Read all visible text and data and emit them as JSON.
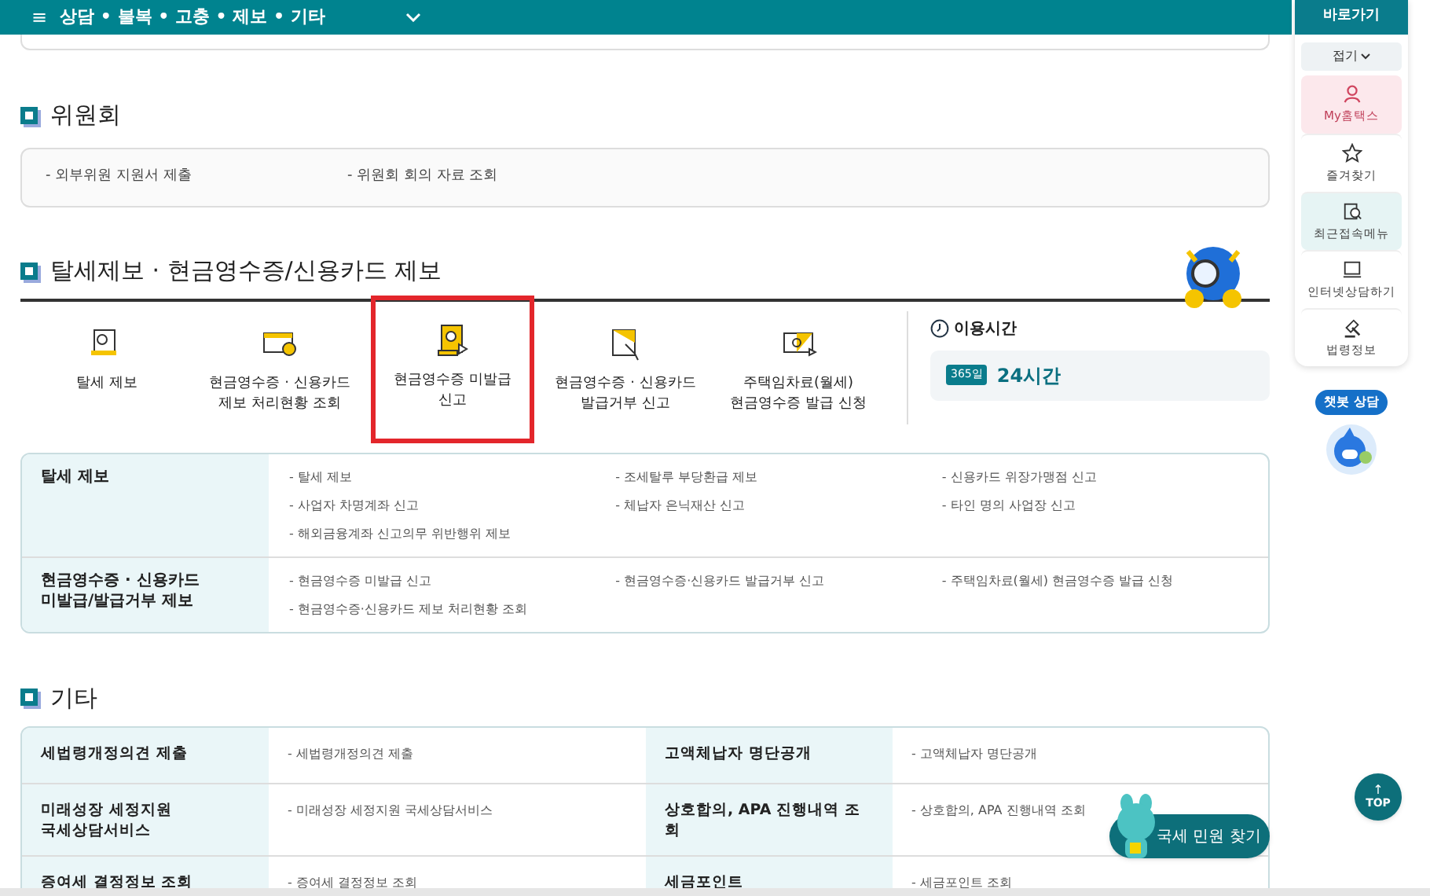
{
  "top_bar": {
    "menu_icon": "≡",
    "title": "상담 • 불복 • 고충 • 제보 • 기타"
  },
  "sections": [
    {
      "kind": "list",
      "title": "위원회",
      "items": [
        "- 외부위원 지원서 제출",
        "- 위원회 회의 자료 조회"
      ]
    },
    {
      "kind": "icons",
      "title": "탈세제보 · 현금영수증/신용카드 제보",
      "icon_items": [
        {
          "label": "탈세 제보",
          "selected": false
        },
        {
          "label": "현금영수증 · 신용카드\n제보 처리현황 조회",
          "selected": false
        },
        {
          "label": "현금영수증 미발급\n신고",
          "selected": true
        },
        {
          "label": "현금영수증 · 신용카드\n발급거부 신고",
          "selected": false
        },
        {
          "label": "주택임차료(월세)\n현금영수증 발급 신청",
          "selected": false
        }
      ],
      "hours": {
        "title": "이용시간",
        "badge": "365일",
        "value": "24시간"
      },
      "rows": [
        {
          "header": "탈세 제보",
          "items": [
            "- 탈세 제보",
            "- 조세탈루 부당환급 제보",
            "- 신용카드 위장가맹점 신고",
            "- 사업자 차명계좌 신고",
            "- 체납자 은닉재산 신고",
            "- 타인 명의 사업장 신고",
            "- 해외금융계좌 신고의무 위반행위 제보"
          ]
        },
        {
          "header": "현금영수증 · 신용카드\n미발급/발급거부 제보",
          "items": [
            "- 현금영수증 미발급 신고",
            "- 현금영수증·신용카드 발급거부 신고",
            "- 주택임차료(월세) 현금영수증 발급 신청",
            "- 현금영수증·신용카드 제보 처리현황 조회"
          ]
        }
      ]
    },
    {
      "kind": "table",
      "title": "기타",
      "rows": [
        [
          "세법령개정의견 제출",
          "- 세법령개정의견 제출",
          "고액체납자 명단공개",
          "- 고액체납자 명단공개"
        ],
        [
          "미래성장 세정지원\n국세상담서비스",
          "- 미래성장 세정지원 국세상담서비스",
          "상호합의, APA 진행내역 조회",
          "- 상호합의, APA 진행내역 조회"
        ],
        [
          "증여세 결정정보 조회",
          "- 증여세 결정정보 조회",
          "세금포인트",
          "- 세금포인트 조회"
        ]
      ]
    }
  ],
  "quick_menu": {
    "title": "바로가기",
    "collapse": "접기",
    "items": [
      {
        "label": "My홈택스",
        "color": "#fce8ec"
      },
      {
        "label": "즐겨찾기"
      },
      {
        "label": "최근접속메뉴",
        "color": "#e6f4f4"
      },
      {
        "label": "인터넷상담하기"
      },
      {
        "label": "법령정보"
      }
    ]
  },
  "chatbot": {
    "label": "챗봇 상담"
  },
  "top_button": {
    "arrow": "↑",
    "label": "TOP"
  },
  "find_button": {
    "label": "국세 민원 찾기"
  }
}
